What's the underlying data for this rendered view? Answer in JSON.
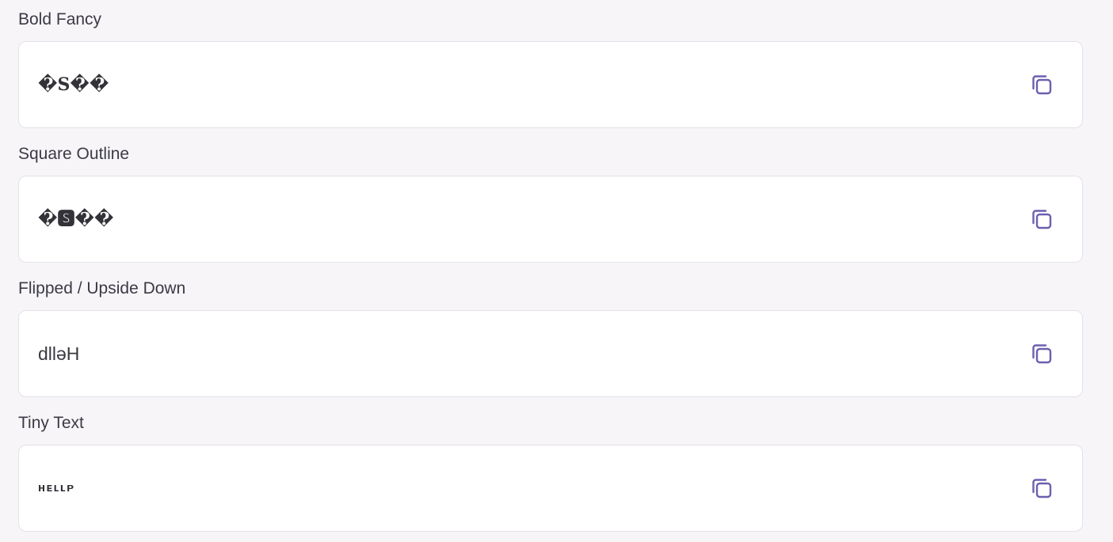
{
  "colors": {
    "background": "#f7f5f8",
    "card": "#ffffff",
    "card_border": "#e4e1e8",
    "icon": "#6b5fb0",
    "label_text": "#3b3a45"
  },
  "items": [
    {
      "label": "Bold Fancy",
      "value": "�𝐒��",
      "icon": "copy-icon"
    },
    {
      "label": "Square Outline",
      "value": "�🆂��",
      "icon": "copy-icon"
    },
    {
      "label": "Flipped / Upside Down",
      "value": "dllǝH",
      "icon": "copy-icon"
    },
    {
      "label": "Tiny Text",
      "value": "ʜᴇʟʟᴘ",
      "icon": "copy-icon"
    }
  ]
}
